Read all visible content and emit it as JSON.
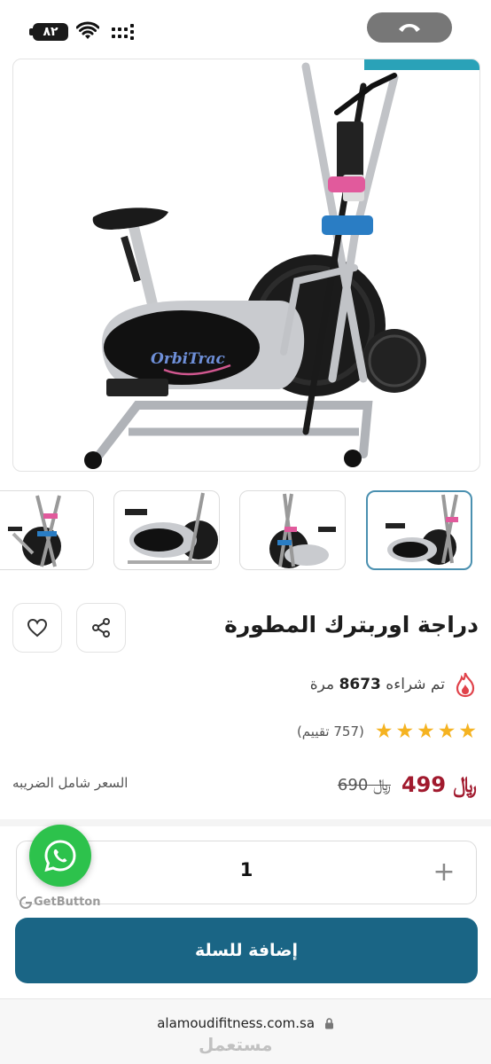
{
  "status_bar": {
    "battery": "٨٢",
    "icons": [
      "wifi-icon",
      "signal-icon",
      "phone-icon"
    ],
    "call_pill_color": "#777777"
  },
  "gallery": {
    "main_image": "exercise-bike-image",
    "brand_text": "OrbiTrac",
    "thumbnails": 4,
    "active_thumbnail": 4,
    "active_border_color": "#4a90b0"
  },
  "product": {
    "title": "دراجة اوربترك المطورة",
    "bought_prefix": "تم شراءه",
    "bought_count": "8673",
    "bought_suffix": "مرة",
    "rating_stars": 5,
    "reviews": "(757 تقييم)",
    "price_new": "499",
    "price_old": "690",
    "currency_symbol": "﷼",
    "price_note": "السعر شامل الضريبه",
    "price_color": "#a11a2e"
  },
  "quantity": {
    "value": "1",
    "plus": "+",
    "minus": "−"
  },
  "whatsapp": {
    "label": "GetButton",
    "color": "#2dc24c"
  },
  "cart": {
    "add_label": "إضافة للسلة",
    "color": "#1a6585"
  },
  "browser": {
    "url": "alamoudifitness.com.sa",
    "watermark": "مستعمل"
  }
}
